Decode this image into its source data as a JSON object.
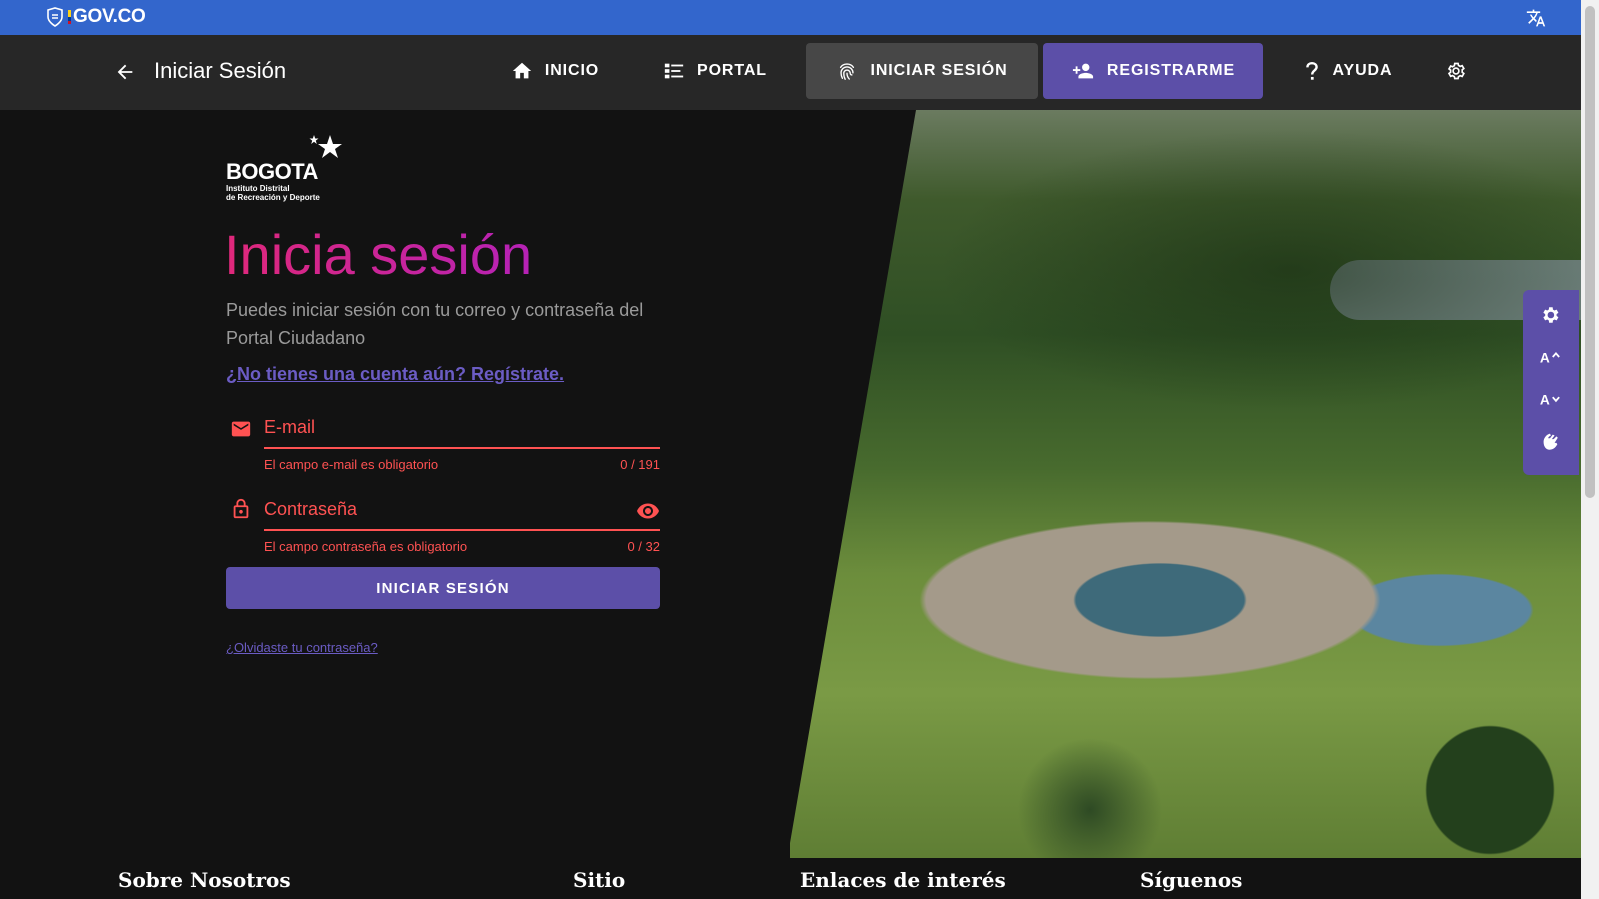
{
  "govbar": {
    "logo_text": "GOV.CO"
  },
  "appbar": {
    "title": "Iniciar Sesión",
    "nav": {
      "inicio": "INICIO",
      "portal": "PORTAL",
      "iniciar": "INICIAR SESIÓN",
      "registrarme": "REGISTRARME",
      "ayuda": "AYUDA"
    }
  },
  "logo": {
    "word": "BOGOTA",
    "sub1": "Instituto Distrital",
    "sub2": "de Recreación y Deporte"
  },
  "form": {
    "headline": "Inicia sesión",
    "subtitle": "Puedes iniciar sesión con tu correo y contraseña del Portal Ciudadano",
    "register_link": "¿No tienes una cuenta aún? Regístrate.",
    "email": {
      "label": "E-mail",
      "error": "El campo e-mail es obligatorio",
      "counter": "0 / 191"
    },
    "password": {
      "label": "Contraseña",
      "error": "El campo contraseña es obligatorio",
      "counter": "0 / 32"
    },
    "submit": "INICIAR SESIÓN",
    "forgot": "¿Olvidaste tu contraseña?"
  },
  "footer": {
    "col1": "Sobre Nosotros",
    "col2": "Sitio",
    "col3": "Enlaces de interés",
    "col4": "Síguenos"
  },
  "colors": {
    "govbar": "#3366cc",
    "accent": "#5c4fa8",
    "error": "#ff5252",
    "headline_start": "#e0287a",
    "headline_end": "#b522b6"
  }
}
